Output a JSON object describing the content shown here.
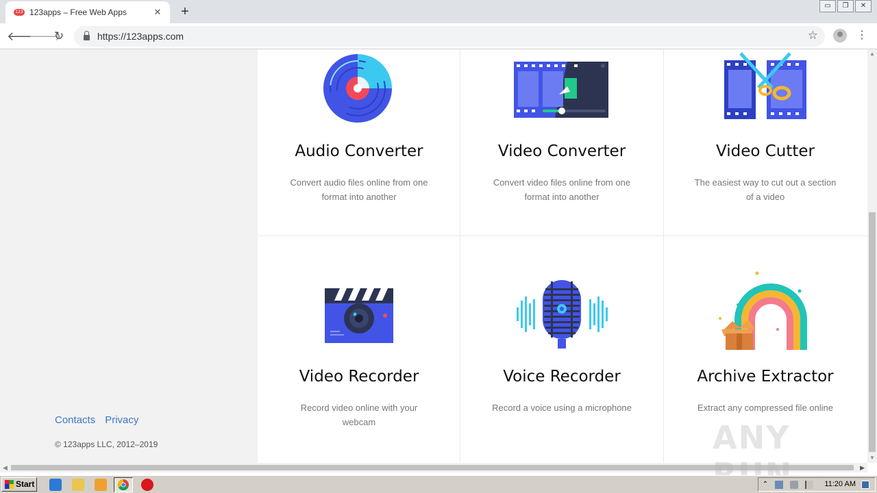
{
  "browser": {
    "tab_title": "123apps – Free Web Apps",
    "favicon_text": "123",
    "tab_close": "✕",
    "new_tab": "+",
    "url": "https://123apps.com",
    "window_controls": [
      "▭",
      "❐",
      "✕"
    ]
  },
  "toolbar_icons": {
    "back": "🡐",
    "forward": "🡒",
    "reload": "↻",
    "star": "☆",
    "menu": "⋮"
  },
  "sidebar": {
    "links": [
      "Contacts",
      "Privacy"
    ],
    "copyright": "© 123apps LLC, 2012–2019"
  },
  "apps": [
    {
      "title": "Audio Converter",
      "description": "Convert audio files online from one format into another",
      "icon": "audio-converter-icon"
    },
    {
      "title": "Video Converter",
      "description": "Convert video files online from one format into another",
      "icon": "video-converter-icon"
    },
    {
      "title": "Video Cutter",
      "description": "The easiest way to cut out a section of a video",
      "icon": "video-cutter-icon"
    },
    {
      "title": "Video Recorder",
      "description": "Record video online with your webcam",
      "icon": "video-recorder-icon"
    },
    {
      "title": "Voice Recorder",
      "description": "Record a voice using a microphone",
      "icon": "voice-recorder-icon"
    },
    {
      "title": "Archive Extractor",
      "description": "Extract any compressed file online",
      "icon": "archive-extractor-icon"
    }
  ],
  "scrollbar": {
    "up": "▲",
    "down": "▼",
    "left": "◀",
    "right": "▶"
  },
  "watermark": "ANY RUN",
  "taskbar": {
    "start_label": "Start",
    "clock": "11:20 AM"
  },
  "colors": {
    "link": "#3d78c9",
    "sidebar_bg": "#f2f2f2",
    "icon_blue": "#4254e6",
    "icon_dark": "#2d3452",
    "icon_cyan": "#3cc9f0",
    "icon_red": "#f04a5a"
  }
}
